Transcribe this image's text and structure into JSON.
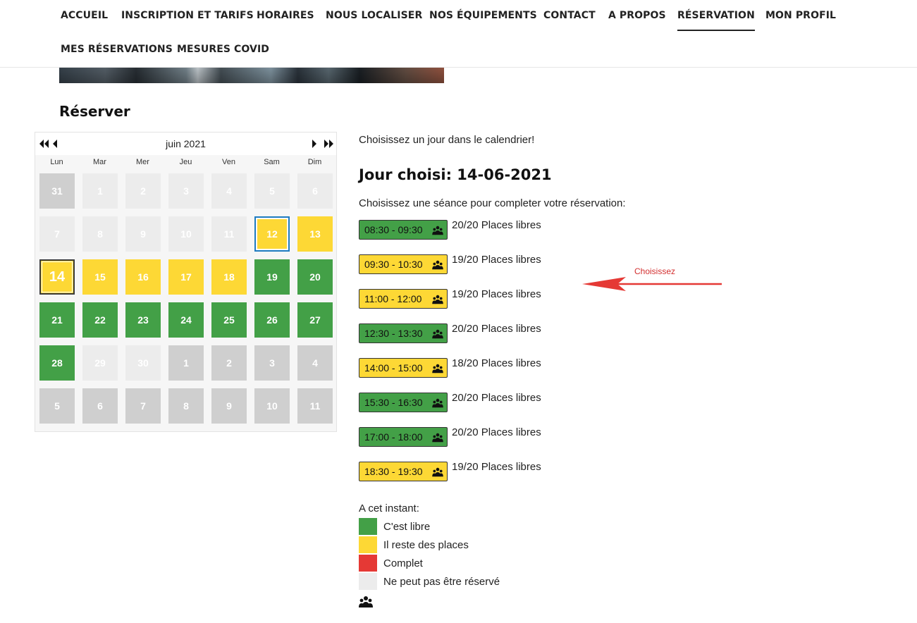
{
  "nav": {
    "items": [
      "ACCUEIL",
      "INSCRIPTION ET TARIFS",
      "HORAIRES",
      "NOUS LOCALISER",
      "NOS ÉQUIPEMENTS",
      "CONTACT",
      "A PROPOS",
      "RÉSERVATION",
      "MON PROFIL",
      "MES RÉSERVATIONS",
      "MESURES COVID"
    ],
    "active": "RÉSERVATION"
  },
  "page": {
    "title": "Réserver"
  },
  "calendar": {
    "month_label": "juin 2021",
    "weekdays": [
      "Lun",
      "Mar",
      "Mer",
      "Jeu",
      "Ven",
      "Sam",
      "Dim"
    ],
    "weeks": [
      [
        {
          "day": "31",
          "status": "other"
        },
        {
          "day": "1",
          "status": "light"
        },
        {
          "day": "2",
          "status": "light"
        },
        {
          "day": "3",
          "status": "light"
        },
        {
          "day": "4",
          "status": "light"
        },
        {
          "day": "5",
          "status": "light"
        },
        {
          "day": "6",
          "status": "light"
        }
      ],
      [
        {
          "day": "7",
          "status": "light"
        },
        {
          "day": "8",
          "status": "light"
        },
        {
          "day": "9",
          "status": "light"
        },
        {
          "day": "10",
          "status": "light"
        },
        {
          "day": "11",
          "status": "light"
        },
        {
          "day": "12",
          "status": "yellow",
          "today": true
        },
        {
          "day": "13",
          "status": "yellow"
        }
      ],
      [
        {
          "day": "14",
          "status": "yellow",
          "selected": true
        },
        {
          "day": "15",
          "status": "yellow"
        },
        {
          "day": "16",
          "status": "yellow"
        },
        {
          "day": "17",
          "status": "yellow"
        },
        {
          "day": "18",
          "status": "yellow"
        },
        {
          "day": "19",
          "status": "green"
        },
        {
          "day": "20",
          "status": "green"
        }
      ],
      [
        {
          "day": "21",
          "status": "green"
        },
        {
          "day": "22",
          "status": "green"
        },
        {
          "day": "23",
          "status": "green"
        },
        {
          "day": "24",
          "status": "green"
        },
        {
          "day": "25",
          "status": "green"
        },
        {
          "day": "26",
          "status": "green"
        },
        {
          "day": "27",
          "status": "green"
        }
      ],
      [
        {
          "day": "28",
          "status": "green"
        },
        {
          "day": "29",
          "status": "light"
        },
        {
          "day": "30",
          "status": "light"
        },
        {
          "day": "1",
          "status": "other"
        },
        {
          "day": "2",
          "status": "other"
        },
        {
          "day": "3",
          "status": "other"
        },
        {
          "day": "4",
          "status": "other"
        }
      ],
      [
        {
          "day": "5",
          "status": "other"
        },
        {
          "day": "6",
          "status": "other"
        },
        {
          "day": "7",
          "status": "other"
        },
        {
          "day": "8",
          "status": "other"
        },
        {
          "day": "9",
          "status": "other"
        },
        {
          "day": "10",
          "status": "other"
        },
        {
          "day": "11",
          "status": "other"
        }
      ]
    ]
  },
  "panel": {
    "instruction": "Choisissez un jour dans le calendrier!",
    "chosen_label": "Jour choisi:",
    "chosen_date": "14-06-2021",
    "session_instruction": "Choisissez une séance pour completer votre réservation:",
    "slots": [
      {
        "time": "08:30 - 09:30",
        "places": "20/20 Places libres",
        "status": "green"
      },
      {
        "time": "09:30 - 10:30",
        "places": "19/20 Places libres",
        "status": "yellow"
      },
      {
        "time": "11:00 - 12:00",
        "places": "19/20 Places libres",
        "status": "yellow"
      },
      {
        "time": "12:30 - 13:30",
        "places": "20/20 Places libres",
        "status": "green"
      },
      {
        "time": "14:00 - 15:00",
        "places": "18/20 Places libres",
        "status": "yellow"
      },
      {
        "time": "15:30 - 16:30",
        "places": "20/20 Places libres",
        "status": "green"
      },
      {
        "time": "17:00 - 18:00",
        "places": "20/20 Places libres",
        "status": "green"
      },
      {
        "time": "18:30 - 19:30",
        "places": "19/20 Places libres",
        "status": "yellow"
      }
    ]
  },
  "annotation": {
    "text": "Choisissez",
    "color": "#d32f2f"
  },
  "legend": {
    "title": "A cet instant:",
    "items": [
      {
        "label": "C'est libre",
        "color": "#43a047"
      },
      {
        "label": "Il reste des places",
        "color": "#fdd835"
      },
      {
        "label": "Complet",
        "color": "#e53935"
      },
      {
        "label": "Ne peut pas être réservé",
        "color": "#ececec"
      }
    ],
    "icon": "group-people-icon"
  },
  "colors": {
    "green": "#43a047",
    "yellow": "#fdd835",
    "red": "#e53935",
    "light": "#ececec",
    "gray": "#cfcfcf"
  }
}
